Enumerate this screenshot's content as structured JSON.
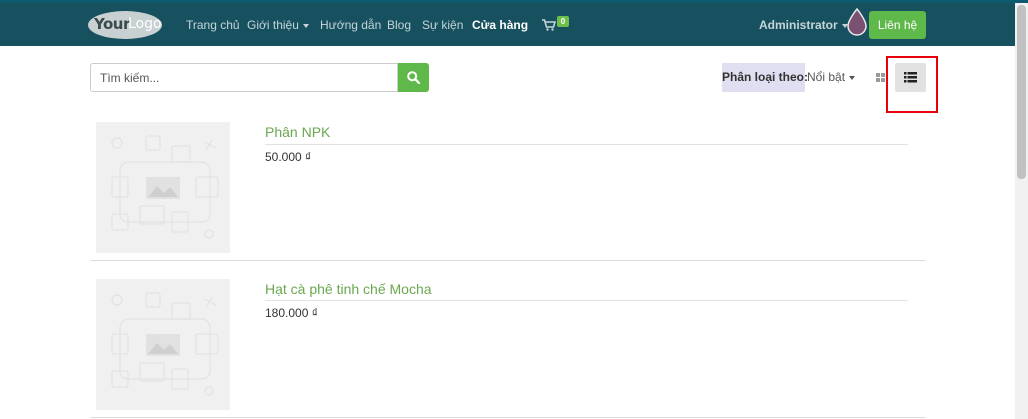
{
  "colors": {
    "navbar_bg": "#17505f",
    "accent_green": "#5fb84a",
    "product_name": "#6aa84f",
    "highlight": "#e8000c"
  },
  "header": {
    "logo_text_1": "Your",
    "logo_text_2": "Logo",
    "nav": [
      {
        "label": "Trang chủ",
        "dropdown": false,
        "active": false
      },
      {
        "label": "Giới thiệu",
        "dropdown": true,
        "active": false
      },
      {
        "label": "Hướng dẫn",
        "dropdown": false,
        "active": false
      },
      {
        "label": "Blog",
        "dropdown": false,
        "active": false
      },
      {
        "label": "Sự kiện",
        "dropdown": false,
        "active": false
      },
      {
        "label": "Cửa hàng",
        "dropdown": false,
        "active": true
      }
    ],
    "cart_icon": "shopping-cart-icon",
    "cart_count": "0",
    "user_label": "Administrator",
    "user_icon": "droplet-icon",
    "contact_label": "Liên hệ"
  },
  "search": {
    "placeholder": "Tìm kiếm...",
    "value": "",
    "button_icon": "search-icon"
  },
  "sort": {
    "label": "Phân loại theo:",
    "value": "Nổi bật"
  },
  "view_toggle": {
    "grid_icon": "grid-view-icon",
    "list_icon": "list-view-icon",
    "active": "list"
  },
  "products": [
    {
      "name": "Phân NPK",
      "price": "50.000 ₫",
      "image_icon": "product-placeholder-icon"
    },
    {
      "name": "Hạt cà phê tinh chế Mocha",
      "price": "180.000 ₫",
      "image_icon": "product-placeholder-icon"
    }
  ]
}
